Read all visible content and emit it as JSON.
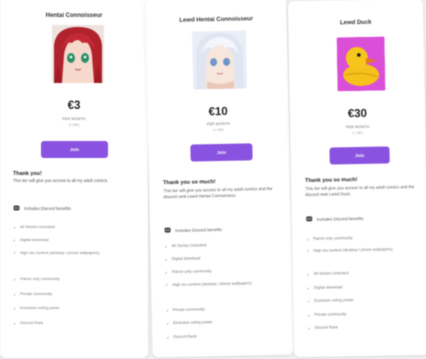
{
  "tiers": [
    {
      "name": "Hentai Connoisseur",
      "price": "€3",
      "period": "PER MONTH",
      "vat": "(+ VAT)",
      "join_label": "Join",
      "thanks": "Thank you!",
      "description": "This tier will give you access to all my adult comics.",
      "discord_label": "Includes Discord benefits",
      "perks": [
        "All Stories Unlocked",
        "Digital download",
        "High res content (desktop / phone wallpapers)",
        "Patron only community",
        "Private community",
        "Exclusive voting power",
        "Discord Rank"
      ],
      "accent": "#8a52e0"
    },
    {
      "name": "Lewd Hentai Connoisseur",
      "price": "€10",
      "period": "PER MONTH",
      "vat": "(+ VAT)",
      "join_label": "Join",
      "thanks": "Thank you so much!",
      "description": "This tier will give you access to all my adult comics and the discord rank Lewd Hentai Connoisseur.",
      "discord_label": "Includes Discord benefits",
      "perks": [
        "All Stories Unlocked",
        "Digital download",
        "Patron only community",
        "High res content (desktop / phone wallpapers)",
        "Private community",
        "Exclusive voting power",
        "Discord Rank"
      ],
      "accent": "#8a52e0"
    },
    {
      "name": "Lewd Duck",
      "price": "€30",
      "period": "PER MONTH",
      "vat": "(+ VAT)",
      "join_label": "Join",
      "thanks": "Thank you so much!",
      "description": "This tier will give you access to all my adult comics and the discord rank Lewd Duck.",
      "discord_label": "Includes Discord benefits",
      "perks": [
        "Patron only community",
        "High res content (desktop / phone wallpapers)",
        "All Stories Unlocked",
        "Digital download",
        "Exclusive voting power",
        "Private community",
        "Discord Rank"
      ],
      "accent": "#8a52e0"
    }
  ]
}
